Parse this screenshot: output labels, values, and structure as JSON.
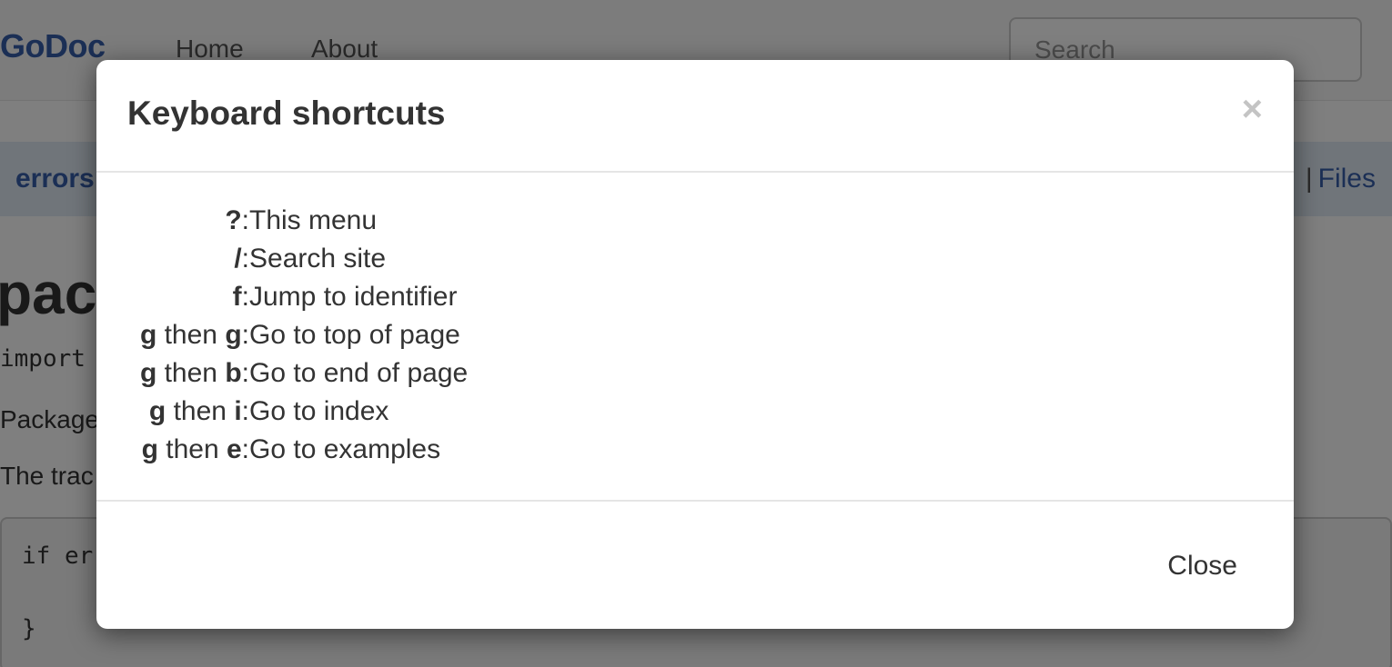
{
  "navbar": {
    "brand": "GoDoc",
    "links": [
      "Home",
      "About"
    ],
    "search_placeholder": "Search"
  },
  "breadcrumb": {
    "left": "errors",
    "right_partial": "s",
    "right_sep": "|",
    "right_link": "Files"
  },
  "content": {
    "title_partial": "pac",
    "import_partial": "import",
    "para1_partial": "Package",
    "para2_partial": "The trac",
    "code_line1": "if er",
    "code_line2": "}"
  },
  "modal": {
    "title": "Keyboard shortcuts",
    "close_x": "×",
    "shortcuts": [
      {
        "keys": [
          {
            "k": "?",
            "b": true
          }
        ],
        "desc": "This menu"
      },
      {
        "keys": [
          {
            "k": "/",
            "b": true
          }
        ],
        "desc": "Search site"
      },
      {
        "keys": [
          {
            "k": "f",
            "b": true
          }
        ],
        "desc": "Jump to identifier"
      },
      {
        "keys": [
          {
            "k": "g",
            "b": true
          },
          {
            "k": " then ",
            "b": false
          },
          {
            "k": "g",
            "b": true
          }
        ],
        "desc": "Go to top of page"
      },
      {
        "keys": [
          {
            "k": "g",
            "b": true
          },
          {
            "k": " then ",
            "b": false
          },
          {
            "k": "b",
            "b": true
          }
        ],
        "desc": "Go to end of page"
      },
      {
        "keys": [
          {
            "k": "g",
            "b": true
          },
          {
            "k": " then ",
            "b": false
          },
          {
            "k": "i",
            "b": true
          }
        ],
        "desc": "Go to index"
      },
      {
        "keys": [
          {
            "k": "g",
            "b": true
          },
          {
            "k": " then ",
            "b": false
          },
          {
            "k": "e",
            "b": true
          }
        ],
        "desc": "Go to examples"
      }
    ],
    "footer_button": "Close"
  },
  "colors": {
    "brand": "#375eab",
    "backdrop": "rgba(0,0,0,0.5)"
  }
}
